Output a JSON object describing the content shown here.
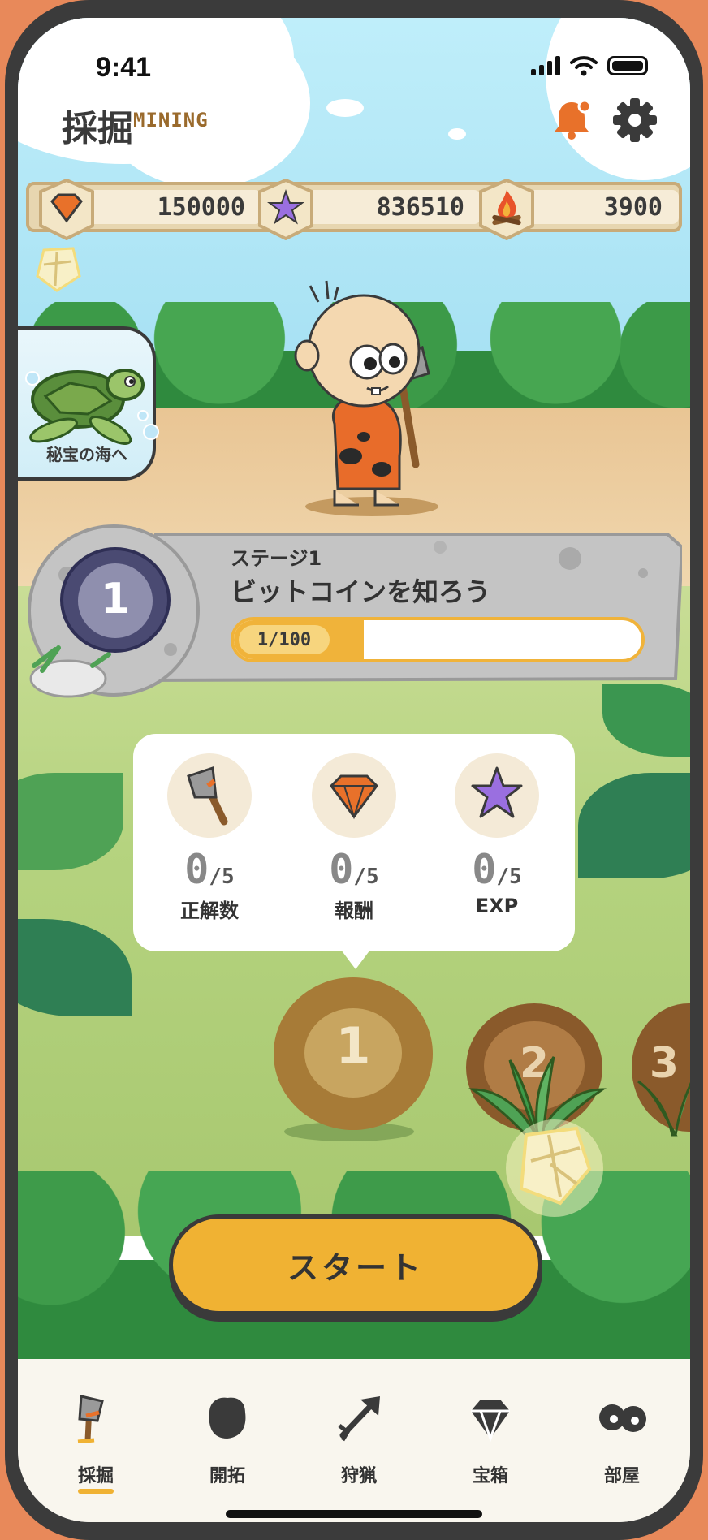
{
  "status": {
    "time": "9:41"
  },
  "header": {
    "title": "採掘",
    "subtitle": "MINING",
    "icons": [
      "bell-icon",
      "gear-icon"
    ]
  },
  "currencies": [
    {
      "icon": "gem-icon",
      "value": "150000"
    },
    {
      "icon": "starfish-icon",
      "value": "836510"
    },
    {
      "icon": "campfire-icon",
      "value": "3900"
    }
  ],
  "side_card": {
    "label": "秘宝の海へ",
    "icon": "turtle-icon"
  },
  "stage": {
    "number": "1",
    "subtitle": "ステージ1",
    "title": "ビットコインを知ろう",
    "progress_text": "1/100",
    "progress": 0.01
  },
  "rewards": [
    {
      "icon": "axe-icon",
      "count": "0",
      "total": "/5",
      "label": "正解数"
    },
    {
      "icon": "gem-icon",
      "count": "0",
      "total": "/5",
      "label": "報酬"
    },
    {
      "icon": "starfish-icon",
      "count": "0",
      "total": "/5",
      "label": "EXP"
    }
  ],
  "nodes": [
    {
      "number": "1"
    },
    {
      "number": "2"
    },
    {
      "number": "3"
    }
  ],
  "start_button": {
    "label": "スタート"
  },
  "tabs": [
    {
      "icon": "axe-icon",
      "label": "採掘",
      "active": true
    },
    {
      "icon": "glove-icon",
      "label": "開拓",
      "active": false
    },
    {
      "icon": "arrow-icon",
      "label": "狩猟",
      "active": false
    },
    {
      "icon": "diamond-icon",
      "label": "宝箱",
      "active": false
    },
    {
      "icon": "eyes-icon",
      "label": "部屋",
      "active": false
    }
  ],
  "colors": {
    "accent": "#f0b233",
    "dark": "#3a3a3a",
    "orange": "#e8895a"
  }
}
